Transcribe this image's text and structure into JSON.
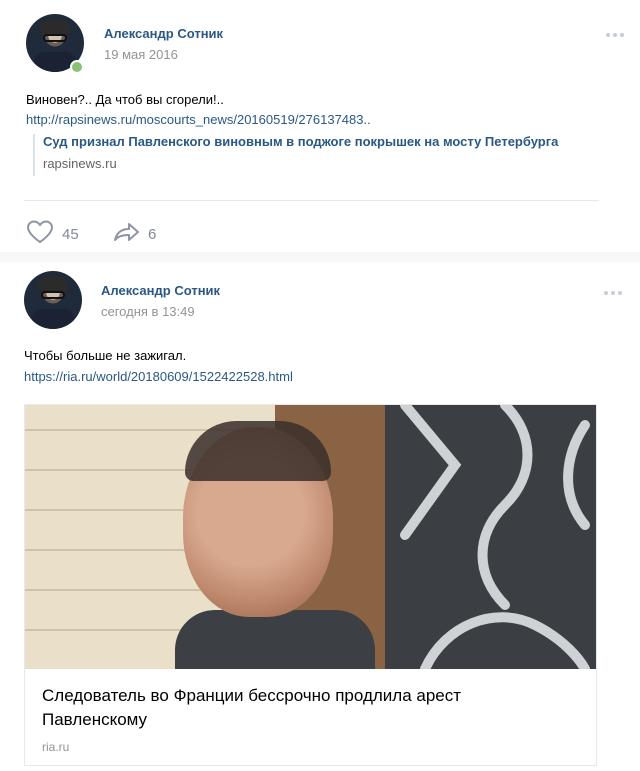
{
  "posts": [
    {
      "author": "Александр Сотник",
      "date": "19 мая 2016",
      "text": "Виновен?.. Да чтоб вы сгорели!..",
      "link": "http://rapsinews.ru/moscourts_news/20160519/276137483..",
      "snippet": {
        "title": "Суд признал Павленского виновным в поджоге покрышек на мосту Петербурга",
        "domain": "rapsinews.ru"
      },
      "likes": "45",
      "shares": "6",
      "online": true
    },
    {
      "author": "Александр Сотник",
      "date": "сегодня в 13:49",
      "text": "Чтобы больше не зажигал.",
      "link": "https://ria.ru/world/20180609/1522422528.html",
      "card": {
        "title": "Следователь во Франции бессрочно продлила арест Павленскому",
        "domain": "ria.ru"
      }
    }
  ],
  "icons": {
    "like": "heart-icon",
    "share": "share-arrow-icon",
    "menu": "more-dots-icon"
  },
  "colors": {
    "link": "#2a5885",
    "muted": "#939393",
    "online": "#8ac176"
  }
}
